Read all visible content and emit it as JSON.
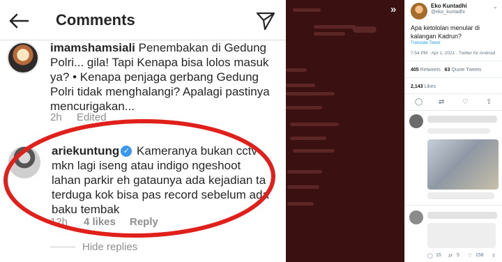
{
  "instagram": {
    "title": "Comments",
    "comment1": {
      "username": "imamshamsiali",
      "text": " Penembakan di Gedung Polri... gila! Tapi Kenapa bisa lolos masuk ya? • Kenapa penjaga gerbang Gedung Polri tidak menghalangi? Apalagi pastinya mencurigakan...",
      "time": "2h",
      "edited": "Edited"
    },
    "comment2": {
      "username": "ariekuntung",
      "verified_mark": "✓",
      "text": " Kameranya bukan cctv mkn lagi iseng atau indigo ngeshoot lahan parkir eh gataunya ada kejadian ta terduga kok bisa pas record sebelum ada baku tembak",
      "time": "12h",
      "likes": "4 likes",
      "reply": "Reply"
    },
    "hide_replies": "Hide replies",
    "annotation_color": "#e0211b"
  },
  "twitter": {
    "dark_panel_expand": "»",
    "author_name": "Eko Kuntadhi",
    "author_handle": "@eko_kuntadhi",
    "tweet_text": "Apa ketololan menular di kalangan Kadrun?",
    "translate": "Translate Tweet",
    "timestamp": "7:54 PM · Apr 1, 2021 · Twitter for Android",
    "retweets_count": "405",
    "retweets_label": "Retweets",
    "quotes_count": "63",
    "quotes_label": "Quote Tweets",
    "likes_count": "2,143",
    "likes_label": "Likes",
    "actions": [
      "reply-icon",
      "retweet-icon",
      "like-icon",
      "share-icon"
    ],
    "bottom_counts": [
      "15",
      "5",
      "158"
    ],
    "accent": "#1da1f2"
  }
}
